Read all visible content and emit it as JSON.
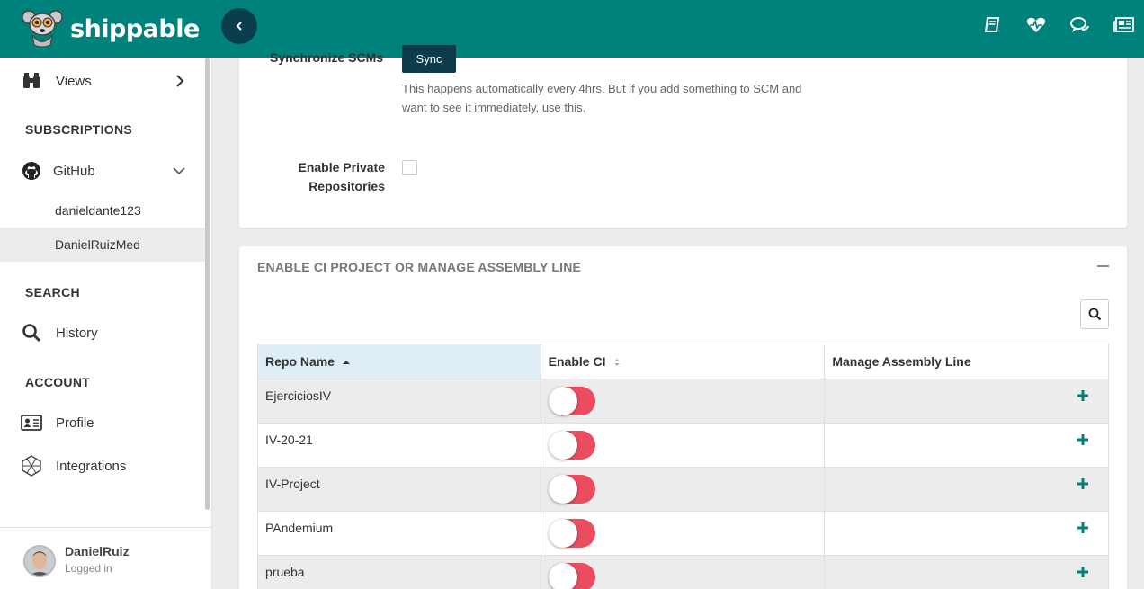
{
  "app": {
    "logo_text": "shippable"
  },
  "topbar": {
    "icons": [
      "book-icon",
      "health-icon",
      "chat-icon",
      "news-icon"
    ]
  },
  "sidebar": {
    "views_label": "Views",
    "subscriptions_heading": "SUBSCRIPTIONS",
    "github_label": "GitHub",
    "github_accounts": [
      "danieldante123",
      "DanielRuizMed"
    ],
    "active_account": "DanielRuizMed",
    "search_heading": "SEARCH",
    "history_label": "History",
    "account_heading": "ACCOUNT",
    "profile_label": "Profile",
    "integrations_label": "Integrations",
    "user": {
      "name": "DanielRuiz",
      "status": "Logged in"
    }
  },
  "settings": {
    "sync_label": "Synchronize SCMs",
    "sync_button": "Sync",
    "sync_help": "This happens automatically every 4hrs. But if you add something to SCM and want to see it immediately, use this.",
    "private_label_line1": "Enable Private",
    "private_label_line2": "Repositories",
    "private_enabled": false
  },
  "projects": {
    "title": "ENABLE CI PROJECT OR MANAGE ASSEMBLY LINE",
    "columns": [
      "Repo Name",
      "Enable CI",
      "Manage Assembly Line"
    ],
    "rows": [
      {
        "name": "EjerciciosIV",
        "ci_enabled": false
      },
      {
        "name": "IV-20-21",
        "ci_enabled": false
      },
      {
        "name": "IV-Project",
        "ci_enabled": false
      },
      {
        "name": "PAndemium",
        "ci_enabled": false
      },
      {
        "name": "prueba",
        "ci_enabled": false
      }
    ]
  },
  "colors": {
    "topbar": "#00827c",
    "accent": "#0d3b4a",
    "toggle_off": "#ea4c60",
    "plus": "#00827c"
  }
}
